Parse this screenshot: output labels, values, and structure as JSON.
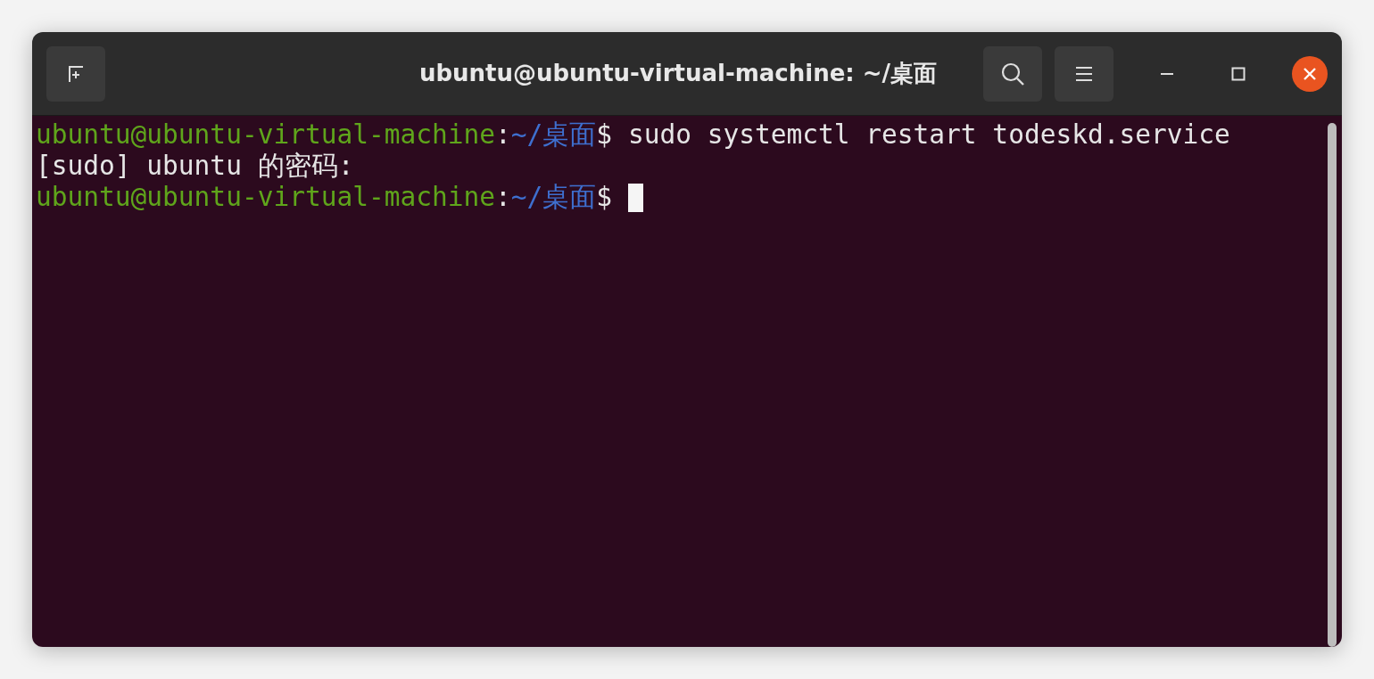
{
  "window": {
    "title": "ubuntu@ubuntu-virtual-machine: ~/桌面"
  },
  "terminal": {
    "lines": [
      {
        "segments": [
          {
            "kind": "user",
            "text": "ubuntu@ubuntu-virtual-machine"
          },
          {
            "kind": "plain",
            "text": ":"
          },
          {
            "kind": "path",
            "text": "~/桌面"
          },
          {
            "kind": "plain",
            "text": "$ sudo systemctl restart todeskd.service"
          }
        ]
      },
      {
        "segments": [
          {
            "kind": "plain",
            "text": "[sudo] ubuntu 的密码:"
          }
        ]
      },
      {
        "segments": [
          {
            "kind": "user",
            "text": "ubuntu@ubuntu-virtual-machine"
          },
          {
            "kind": "plain",
            "text": ":"
          },
          {
            "kind": "path",
            "text": "~/桌面"
          },
          {
            "kind": "plain",
            "text": "$ "
          }
        ],
        "cursor": true
      }
    ]
  }
}
